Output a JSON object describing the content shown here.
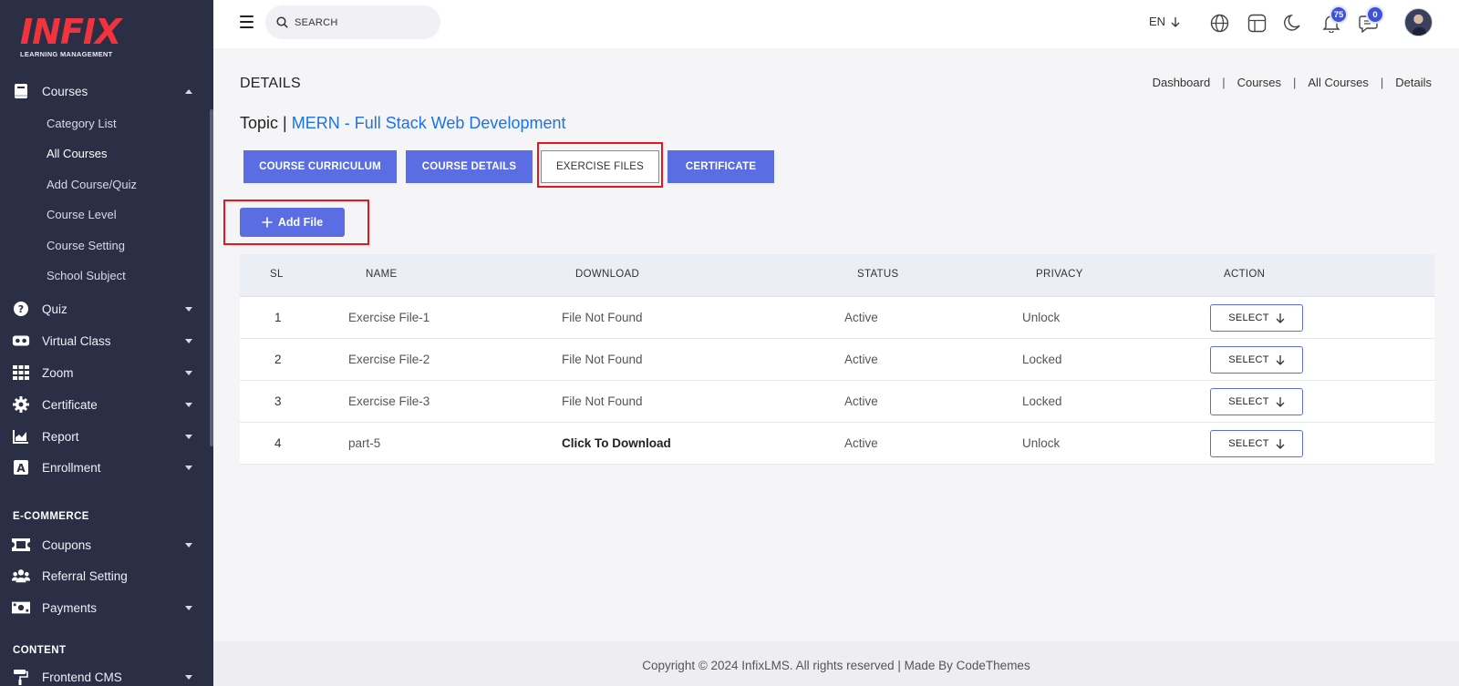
{
  "logo": {
    "text": "INFIX",
    "sub": "LEARNING MANAGEMENT"
  },
  "sidebar": {
    "courses": {
      "label": "Courses",
      "children": [
        "Category List",
        "All Courses",
        "Add Course/Quiz",
        "Course Level",
        "Course Setting",
        "School Subject"
      ]
    },
    "items": [
      {
        "label": "Quiz",
        "icon": "question-icon"
      },
      {
        "label": "Virtual Class",
        "icon": "vr-icon"
      },
      {
        "label": "Zoom",
        "icon": "grid-icon"
      },
      {
        "label": "Certificate",
        "icon": "gear-badge-icon"
      },
      {
        "label": "Report",
        "icon": "chart-icon"
      },
      {
        "label": "Enrollment",
        "icon": "enrollment-icon"
      }
    ],
    "ecommerce_title": "E-COMMERCE",
    "ecommerce": [
      {
        "label": "Coupons",
        "icon": "ticket-icon"
      },
      {
        "label": "Referral Setting",
        "icon": "users-icon"
      },
      {
        "label": "Payments",
        "icon": "money-icon"
      }
    ],
    "content_title": "CONTENT",
    "content": [
      {
        "label": "Frontend CMS",
        "icon": "paint-roller-icon"
      }
    ]
  },
  "topbar": {
    "search_placeholder": "SEARCH",
    "lang": "EN",
    "notification_count": "75",
    "message_count": "0"
  },
  "page": {
    "title": "DETAILS",
    "breadcrumb": [
      "Dashboard",
      "Courses",
      "All Courses",
      "Details"
    ],
    "topic_label": "Topic |",
    "topic_name": "MERN - Full Stack Web Development"
  },
  "tabs": [
    "COURSE CURRICULUM",
    "COURSE DETAILS",
    "EXERCISE FILES",
    "CERTIFICATE"
  ],
  "add_button": "Add File",
  "table": {
    "headers": [
      "SL",
      "NAME",
      "DOWNLOAD",
      "STATUS",
      "PRIVACY",
      "ACTION"
    ],
    "rows": [
      {
        "sl": "1",
        "name": "Exercise File-1",
        "download": "File Not Found",
        "status": "Active",
        "privacy": "Unlock",
        "action": "SELECT"
      },
      {
        "sl": "2",
        "name": "Exercise File-2",
        "download": "File Not Found",
        "status": "Active",
        "privacy": "Locked",
        "action": "SELECT"
      },
      {
        "sl": "3",
        "name": "Exercise File-3",
        "download": "File Not Found",
        "status": "Active",
        "privacy": "Locked",
        "action": "SELECT"
      },
      {
        "sl": "4",
        "name": "part-5",
        "download": "Click To Download",
        "status": "Active",
        "privacy": "Unlock",
        "action": "SELECT"
      }
    ]
  },
  "footer": "Copyright © 2024 InfixLMS. All rights reserved | Made By CodeThemes",
  "colors": {
    "sidebar_bg": "#2a2f45",
    "accent": "#5b6de3",
    "brand": "#f0333d",
    "highlight": "#e8141c",
    "link": "#1a73e8"
  }
}
